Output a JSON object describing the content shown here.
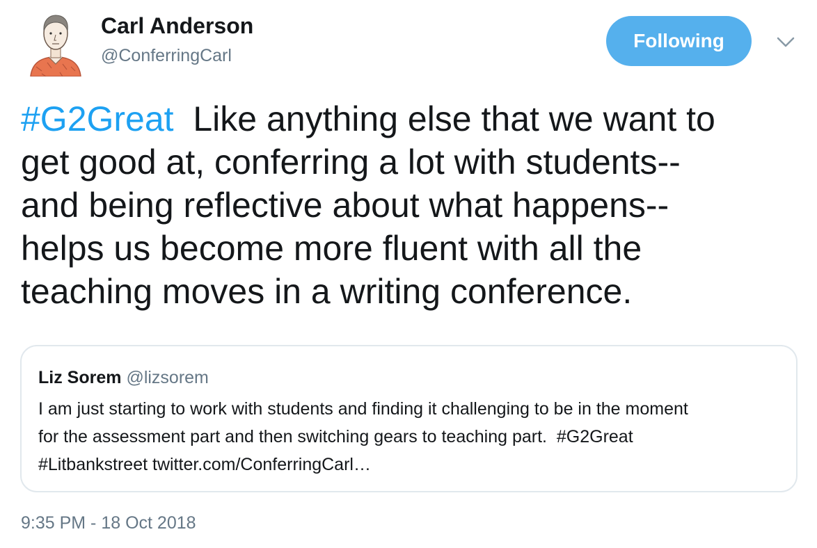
{
  "colors": {
    "accent": "#1da1f2",
    "follow_button_bg": "#55b0ed",
    "secondary_text": "#657786",
    "card_border": "#e1e8ed"
  },
  "author": {
    "name": "Carl Anderson",
    "handle": "@ConferringCarl",
    "avatar_icon": "avatar-illustration"
  },
  "follow_button": {
    "label": "Following"
  },
  "menu": {
    "icon": "chevron-down-icon"
  },
  "tweet": {
    "lines": [
      {
        "hashtag": "#G2Great",
        "text": "  Like anything else that we want to"
      },
      {
        "text": "get good at, conferring a lot with students--"
      },
      {
        "text": "and being reflective about what happens--"
      },
      {
        "text": "helps us become more fluent with all the"
      },
      {
        "text": "teaching moves in a writing conference."
      }
    ]
  },
  "quoted_tweet": {
    "name": "Liz Sorem",
    "handle": "@lizsorem",
    "lines": [
      {
        "text": "I am just starting to work with students and finding it challenging to be in the moment"
      },
      {
        "text": "for the assessment part and then switching gears to teaching part.  ",
        "hashtag": "#G2Great"
      },
      {
        "hashtag": "#Litbankstreet",
        "link": " twitter.com/ConferringCarl…"
      }
    ]
  },
  "timestamp": "9:35 PM - 18 Oct 2018"
}
